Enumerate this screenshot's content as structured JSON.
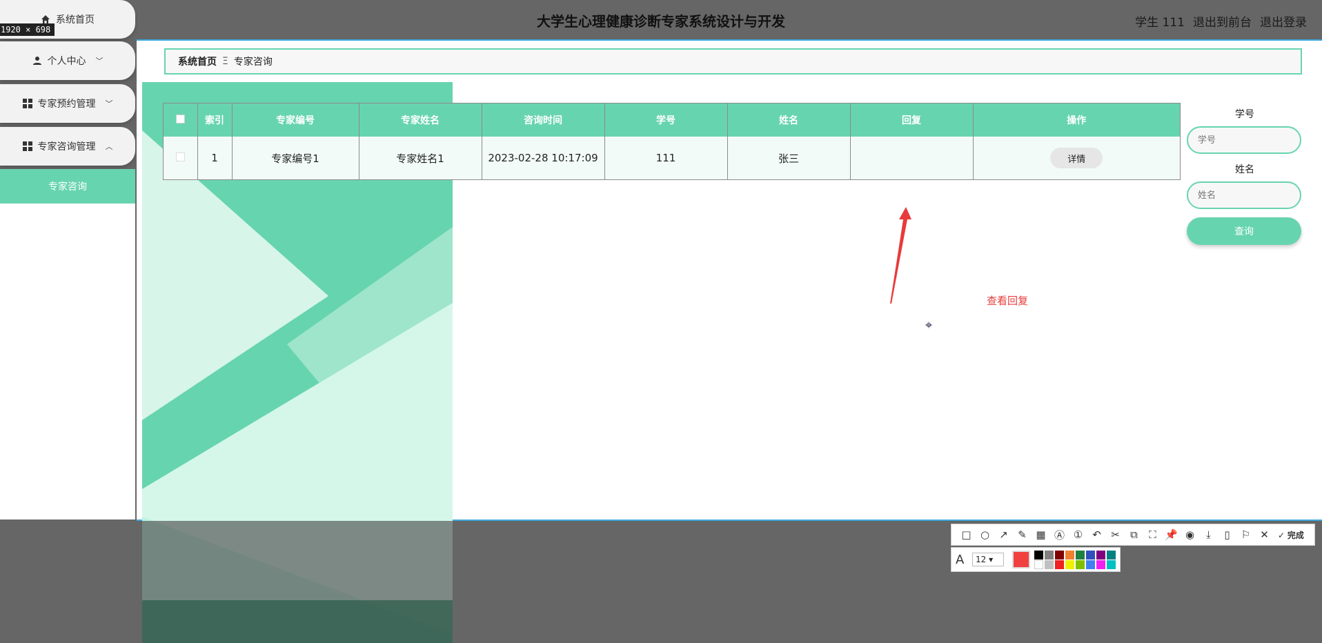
{
  "header": {
    "title": "大学生心理健康诊断专家系统设计与开发",
    "user": "学生 111",
    "to_front": "退出到前台",
    "logout": "退出登录"
  },
  "dimension_chip": "1920 × 698",
  "sidebar": {
    "items": [
      {
        "label": "系统首页",
        "icon": "home-icon"
      },
      {
        "label": "个人中心",
        "icon": "user-icon"
      },
      {
        "label": "专家预约管理",
        "icon": "grid-icon"
      },
      {
        "label": "专家咨询管理",
        "icon": "grid-icon"
      }
    ],
    "active": "专家咨询"
  },
  "breadcrumb": {
    "home": "系统首页",
    "separator": "Ξ",
    "current": "专家咨询"
  },
  "table": {
    "headers": [
      "索引",
      "专家编号",
      "专家姓名",
      "咨询时间",
      "学号",
      "姓名",
      "回复",
      "操作"
    ],
    "rows": [
      {
        "index": "1",
        "expert_no": "专家编号1",
        "expert_name": "专家姓名1",
        "time": "2023-02-28 10:17:09",
        "student_no": "111",
        "name": "张三",
        "reply": "",
        "action": "详情"
      }
    ]
  },
  "search": {
    "student_no_label": "学号",
    "student_no_placeholder": "学号",
    "name_label": "姓名",
    "name_placeholder": "姓名",
    "button": "查询"
  },
  "annotation": {
    "text": "查看回复",
    "color": "#e83b3b"
  },
  "toolbar": {
    "done_label": "完成",
    "font_size": "12",
    "current_color": "#f14040",
    "palette": [
      "#000000",
      "#808080",
      "#800000",
      "#f08030",
      "#208040",
      "#3050c0",
      "#800080",
      "#008080",
      "#ffffff",
      "#c0c0c0",
      "#f02020",
      "#f0f000",
      "#80c000",
      "#4080f0",
      "#f020f0",
      "#00c0c0"
    ]
  },
  "colors": {
    "accent": "#67d4b0",
    "overlay": "#666666"
  }
}
